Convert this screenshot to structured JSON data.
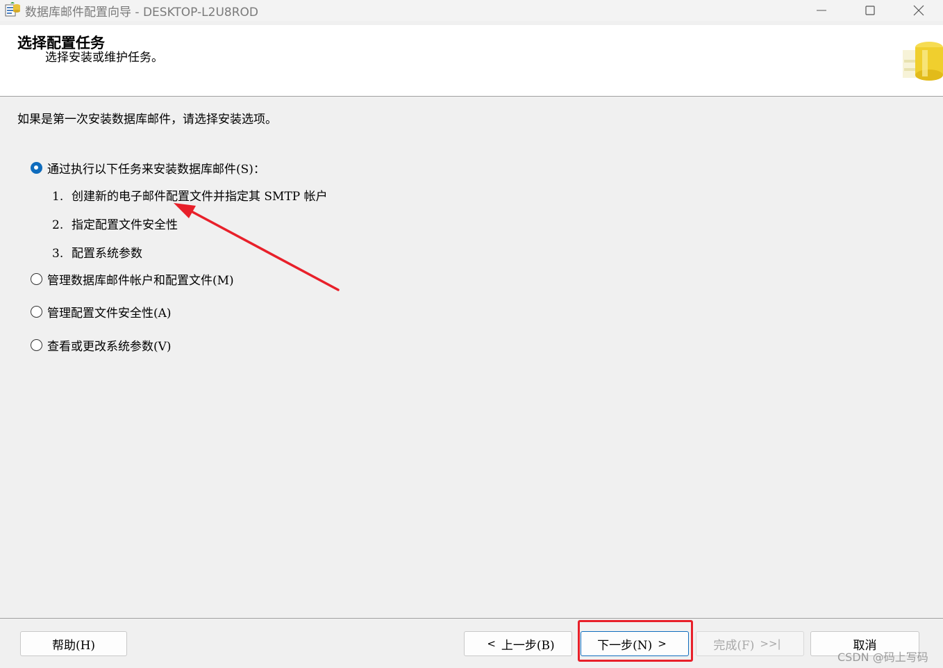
{
  "window": {
    "title": "数据库邮件配置向导 - DESKTOP-L2U8ROD"
  },
  "header": {
    "title": "选择配置任务",
    "subtitle": "选择安装或维护任务。"
  },
  "main": {
    "intro": "如果是第一次安装数据库邮件，请选择安装选项。",
    "options": [
      {
        "label": "通过执行以下任务来安装数据库邮件(S)：",
        "selected": true
      },
      {
        "label": "管理数据库邮件帐户和配置文件(M)",
        "selected": false
      },
      {
        "label": "管理配置文件安全性(A)",
        "selected": false
      },
      {
        "label": "查看或更改系统参数(V)",
        "selected": false
      }
    ],
    "steps": [
      {
        "num": "1.",
        "text": "创建新的电子邮件配置文件并指定其 SMTP 帐户"
      },
      {
        "num": "2.",
        "text": "指定配置文件安全性"
      },
      {
        "num": "3.",
        "text": "配置系统参数"
      }
    ]
  },
  "footer": {
    "help": "帮助(H)",
    "back": "上一步(B)",
    "next": "下一步(N)",
    "finish": "完成(F)",
    "cancel": "取消"
  },
  "watermark": "CSDN @码上写码",
  "colors": {
    "accent": "#0f6cbd",
    "annotation": "#e8202a"
  }
}
